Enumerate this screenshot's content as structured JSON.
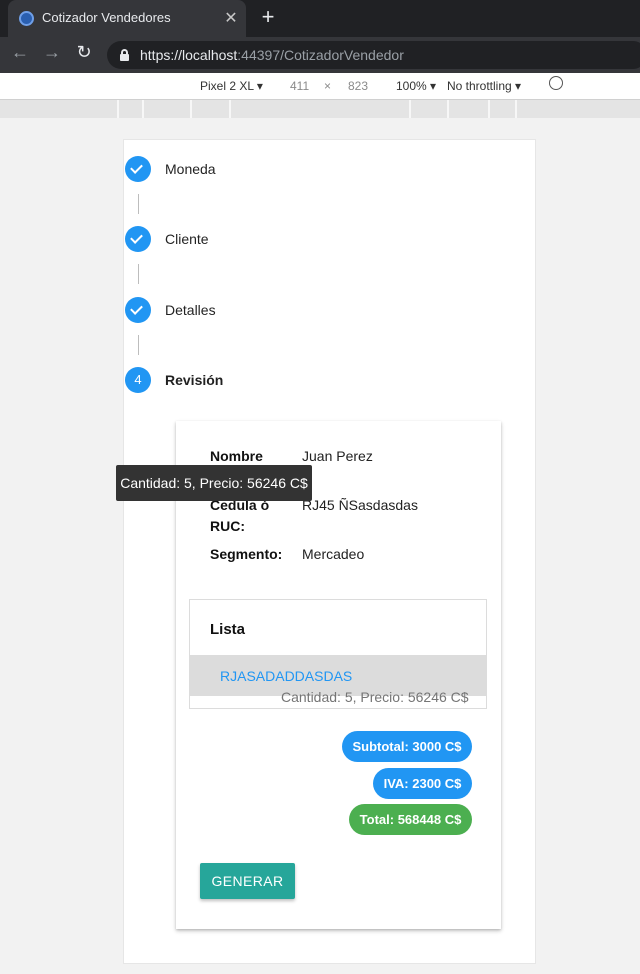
{
  "browser": {
    "tab_title": "Cotizador Vendedores",
    "close_glyph": "✕",
    "new_tab_glyph": "+",
    "url_host": "https://localhost",
    "url_rest": ":44397/CotizadorVendedor",
    "back_glyph": "←",
    "forward_glyph": "→",
    "reload_glyph": "↻"
  },
  "devtools": {
    "device": "Pixel 2 XL ▾",
    "width": "411",
    "times": "×",
    "height": "823",
    "zoom": "100% ▾",
    "throttling": "No throttling ▾",
    "rotate_glyph": "⃠"
  },
  "stepper": {
    "steps": [
      {
        "label": "Moneda",
        "state": "complete"
      },
      {
        "label": "Cliente",
        "state": "complete"
      },
      {
        "label": "Detalles",
        "state": "complete"
      },
      {
        "label": "Revisión",
        "state": "active",
        "number": "4"
      }
    ]
  },
  "review": {
    "rows": [
      {
        "label": "Nombre cliente:",
        "value": "Juan Perez"
      },
      {
        "label": "Cedula ó RUC:",
        "value": "RJ45 ÑSasdasdas"
      },
      {
        "label": "Segmento:",
        "value": "Mercadeo"
      }
    ],
    "list_title": "Lista",
    "list_items": [
      {
        "title": "RJASADADDASDAS",
        "subtitle": "Cantidad: 5, Precio: 56246 C$"
      }
    ],
    "tooltip": "Cantidad: 5, Precio: 56246 C$",
    "subtotal": "Subtotal: 3000 C$",
    "iva": "IVA: 2300 C$",
    "total": "Total: 568448 C$",
    "generate_button": "GENERAR"
  },
  "colors": {
    "primary": "#2196f3",
    "success": "#4caf50",
    "teal_button": "#26a69a"
  }
}
